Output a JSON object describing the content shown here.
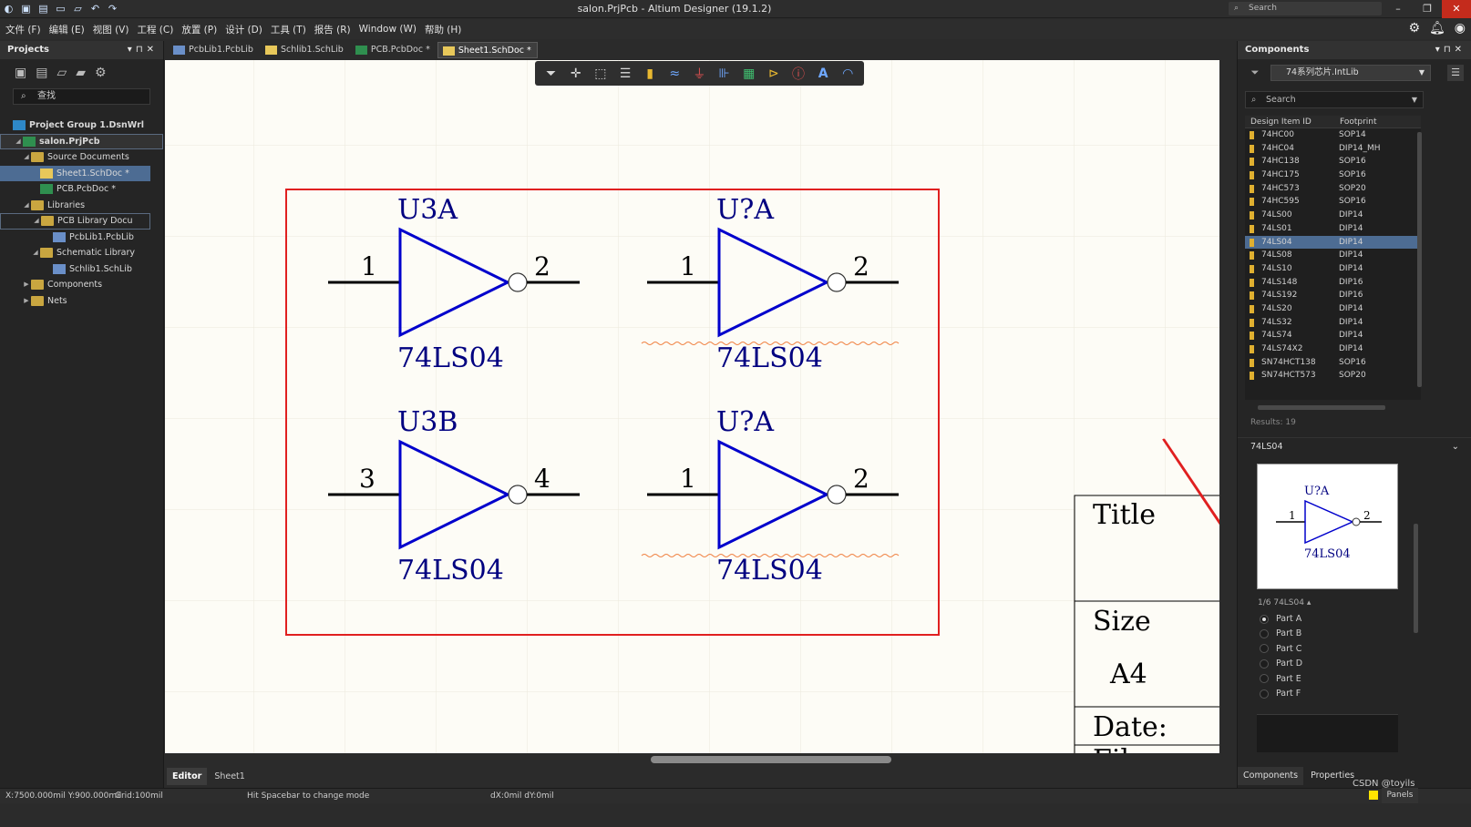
{
  "window": {
    "title": "salon.PrjPcb - Altium Designer (19.1.2)",
    "search_placeholder": "Search"
  },
  "menu": [
    "文件 (F)",
    "编辑 (E)",
    "视图 (V)",
    "工程 (C)",
    "放置 (P)",
    "设计 (D)",
    "工具 (T)",
    "报告 (R)",
    "Window (W)",
    "帮助 (H)"
  ],
  "projects_panel": {
    "title": "Projects",
    "search_placeholder": "查找",
    "tree": [
      {
        "label": "Project Group 1.DsnWrl",
        "level": 0,
        "icon": "project-group-icon"
      },
      {
        "label": "salon.PrjPcb",
        "level": 0,
        "icon": "pcb-project-icon"
      },
      {
        "label": "Source Documents",
        "level": 1,
        "icon": "folder-icon"
      },
      {
        "label": "Sheet1.SchDoc *",
        "level": 2,
        "icon": "schematic-doc-icon"
      },
      {
        "label": "PCB.PcbDoc *",
        "level": 2,
        "icon": "pcb-doc-icon"
      },
      {
        "label": "Libraries",
        "level": 1,
        "icon": "folder-icon"
      },
      {
        "label": "PCB Library Docu",
        "level": 2,
        "icon": "folder-icon"
      },
      {
        "label": "PcbLib1.PcbLib",
        "level": 3,
        "icon": "pcb-lib-icon"
      },
      {
        "label": "Schematic Library",
        "level": 2,
        "icon": "folder-icon"
      },
      {
        "label": "Schlib1.SchLib",
        "level": 3,
        "icon": "sch-lib-icon"
      },
      {
        "label": "Components",
        "level": 1,
        "icon": "folder-icon"
      },
      {
        "label": "Nets",
        "level": 1,
        "icon": "folder-icon"
      }
    ]
  },
  "doc_tabs": [
    "PcbLib1.PcbLib",
    "Schlib1.SchLib",
    "PCB.PcbDoc *",
    "Sheet1.SchDoc *"
  ],
  "schematic": {
    "parts": [
      {
        "designator": "U3A",
        "comment": "74LS04",
        "pin_in": "1",
        "pin_out": "2"
      },
      {
        "designator": "U?A",
        "comment": "74LS04",
        "pin_in": "1",
        "pin_out": "2"
      },
      {
        "designator": "U3B",
        "comment": "74LS04",
        "pin_in": "3",
        "pin_out": "4"
      },
      {
        "designator": "U?A",
        "comment": "74LS04",
        "pin_in": "1",
        "pin_out": "2"
      }
    ],
    "title_block": {
      "title": "Title",
      "size": "Size",
      "size_value": "A4",
      "date": "Date:",
      "file": "File"
    },
    "colors": {
      "symbol": "#0000cc",
      "text": "#000080",
      "selection": "#e02020"
    }
  },
  "editor_tabs": [
    "Editor",
    "Sheet1"
  ],
  "components_panel": {
    "title": "Components",
    "library": "74系列芯片.IntLib",
    "search_placeholder": "Search",
    "columns": [
      "Design Item ID",
      "Footprint"
    ],
    "rows": [
      [
        "74HC00",
        "SOP14"
      ],
      [
        "74HC04",
        "DIP14_MH"
      ],
      [
        "74HC138",
        "SOP16"
      ],
      [
        "74HC175",
        "SOP16"
      ],
      [
        "74HC573",
        "SOP20"
      ],
      [
        "74HC595",
        "SOP16"
      ],
      [
        "74LS00",
        "DIP14"
      ],
      [
        "74LS01",
        "DIP14"
      ],
      [
        "74LS04",
        "DIP14"
      ],
      [
        "74LS08",
        "DIP14"
      ],
      [
        "74LS10",
        "DIP14"
      ],
      [
        "74LS148",
        "DIP16"
      ],
      [
        "74LS192",
        "DIP16"
      ],
      [
        "74LS20",
        "DIP14"
      ],
      [
        "74LS32",
        "DIP14"
      ],
      [
        "74LS74",
        "DIP14"
      ],
      [
        "74LS74X2",
        "DIP14"
      ],
      [
        "SN74HCT138",
        "SOP16"
      ],
      [
        "SN74HCT573",
        "SOP20"
      ]
    ],
    "selected_row": 8,
    "results": "Results: 19",
    "preview_name": "74LS04",
    "preview": {
      "designator": "U?A",
      "comment": "74LS04",
      "pin_in": "1",
      "pin_out": "2"
    },
    "part_selector": "1/6  74LS04 ▴",
    "parts": [
      "Part A",
      "Part B",
      "Part C",
      "Part D",
      "Part E",
      "Part F"
    ],
    "selected_part": 0,
    "bottom_tabs": [
      "Components",
      "Properties"
    ]
  },
  "status": {
    "coords": "X:7500.000mil Y:900.000mil",
    "grid": "Grid:100mil",
    "hint": "Hit Spacebar to change mode",
    "delta": "dX:0mil dY:0mil",
    "panels": "Panels",
    "watermark": "CSDN @toyils"
  }
}
